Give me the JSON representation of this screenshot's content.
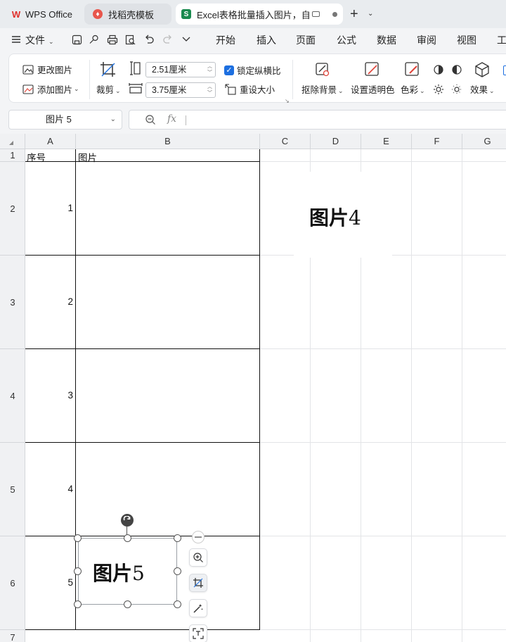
{
  "tabs": {
    "wps": "WPS Office",
    "daoke": "找稻壳模板",
    "excel": "Excel表格批量插入图片，自动"
  },
  "menubar": {
    "file": "文件",
    "items": [
      "开始",
      "插入",
      "页面",
      "公式",
      "数据",
      "审阅",
      "视图",
      "工"
    ]
  },
  "ribbon": {
    "change_picture": "更改图片",
    "add_picture": "添加图片",
    "crop": "裁剪",
    "height_value": "2.51厘米",
    "width_value": "3.75厘米",
    "lock_ratio": "锁定纵横比",
    "reset_size": "重设大小",
    "remove_background": "抠除背景",
    "set_transparent": "设置透明色",
    "color": "色彩",
    "effects": "效果"
  },
  "formula_bar": {
    "name_box": "图片 5",
    "fx": "fx"
  },
  "columns": [
    "A",
    "B",
    "C",
    "D",
    "E",
    "F",
    "G"
  ],
  "rows": [
    "1",
    "2",
    "3",
    "4",
    "5",
    "6",
    "7"
  ],
  "table": {
    "header_a": "序号",
    "header_b": "图片",
    "numbers": [
      "1",
      "2",
      "3",
      "4",
      "5"
    ]
  },
  "pictures": {
    "pic4_text": "图片",
    "pic4_digit": "4",
    "pic5_text": "图片",
    "pic5_digit": "5"
  }
}
